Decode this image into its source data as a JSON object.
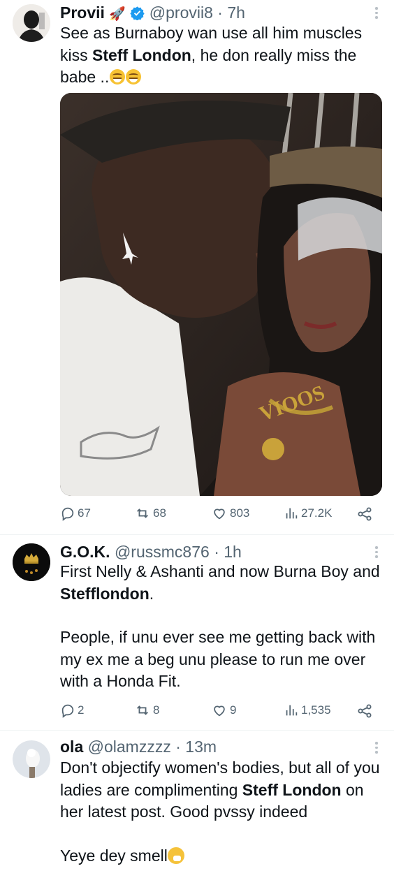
{
  "tweets": [
    {
      "name": "Provii",
      "name_emoji": "🚀",
      "handle": "@provii8",
      "time": "7h",
      "text_parts": [
        "See as Burnaboy wan use all him muscles kiss ",
        "Steff London",
        ", he don really miss the babe .."
      ],
      "stats": {
        "replies": "67",
        "retweets": "68",
        "likes": "803",
        "views": "27.2K"
      }
    },
    {
      "name": "G.O.K.",
      "handle": "@russmc876",
      "time": "1h",
      "line1_parts": [
        "First Nelly & Ashanti and now Burna Boy and ",
        "Stefflondon",
        "."
      ],
      "paragraph2": "People, if unu ever see me getting back with my ex me a beg unu please to run me over with a Honda Fit.",
      "stats": {
        "replies": "2",
        "retweets": "8",
        "likes": "9",
        "views": "1,535"
      }
    },
    {
      "name": "ola",
      "handle": "@olamzzzz",
      "time": "13m",
      "text_parts": [
        "Don't objectify women's bodies, but all of you ladies are complimenting ",
        "Steff London",
        " on her latest post. Good pvssy indeed"
      ],
      "paragraph2": "Yeye dey smell"
    }
  ],
  "icons": [
    "rocket-emoji",
    "verified-badge-icon",
    "more-icon",
    "reply-icon",
    "retweet-icon",
    "like-icon",
    "views-icon",
    "share-icon",
    "grin-sweat-emoji",
    "sneezing-face-emoji"
  ],
  "colors": {
    "text": "#0f1419",
    "secondary": "#536471",
    "verified": "#1d9bf0",
    "divider": "#eff3f4"
  }
}
